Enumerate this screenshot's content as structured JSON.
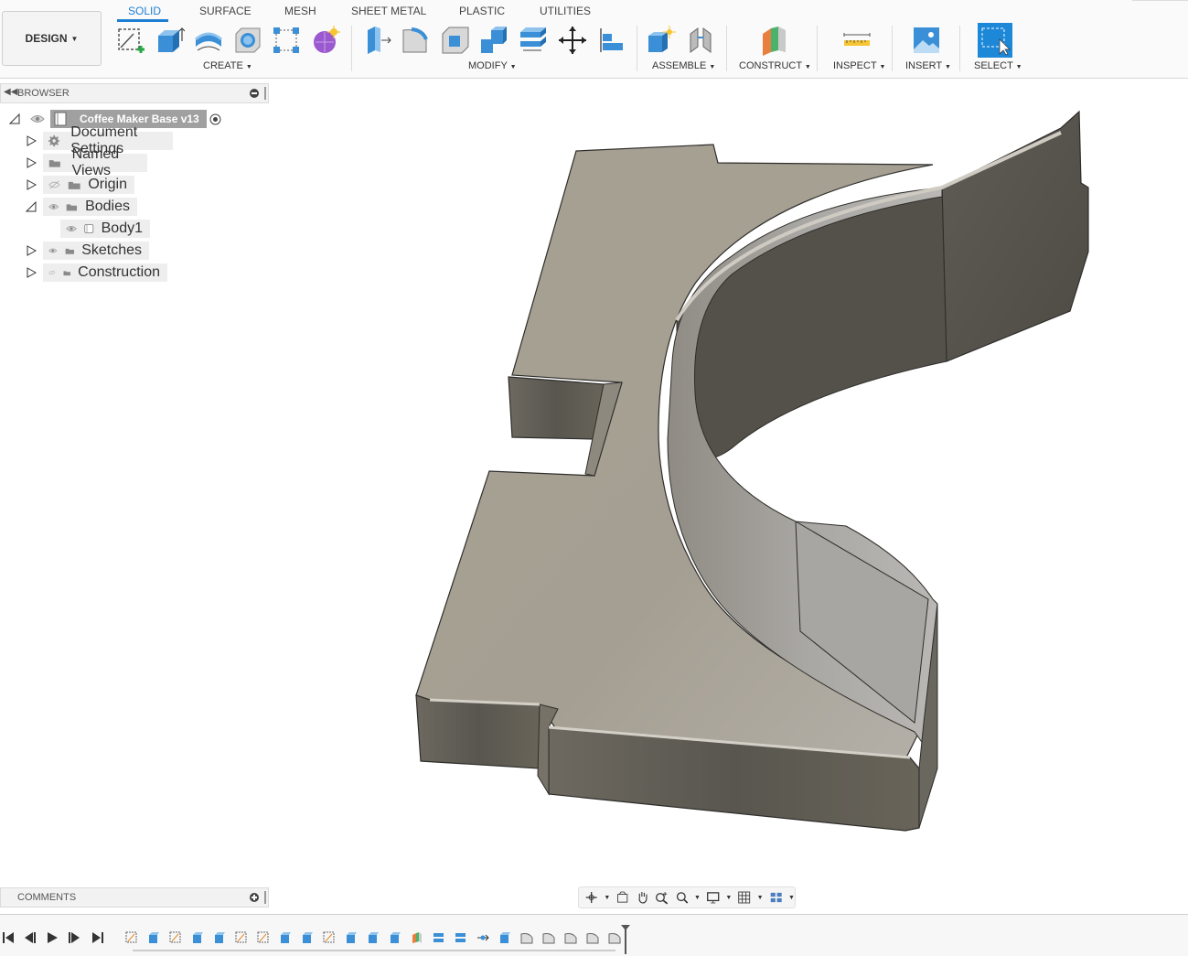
{
  "workspace": {
    "label": "DESIGN"
  },
  "tabs": [
    {
      "label": "SOLID",
      "active": true
    },
    {
      "label": "SURFACE",
      "active": false
    },
    {
      "label": "MESH",
      "active": false
    },
    {
      "label": "SHEET METAL",
      "active": false
    },
    {
      "label": "PLASTIC",
      "active": false
    },
    {
      "label": "UTILITIES",
      "active": false
    }
  ],
  "groups": {
    "create": "CREATE",
    "modify": "MODIFY",
    "assemble": "ASSEMBLE",
    "construct": "CONSTRUCT",
    "inspect": "INSPECT",
    "insert": "INSERT",
    "select": "SELECT"
  },
  "browser": {
    "title": "BROWSER",
    "document": "Coffee Maker Base v13",
    "items": [
      {
        "label": "Document Settings",
        "icon": "gear-icon"
      },
      {
        "label": "Named Views",
        "icon": "folder-icon"
      },
      {
        "label": "Origin",
        "icon": "folder-icon",
        "visibility": "hidden"
      },
      {
        "label": "Bodies",
        "icon": "folder-icon",
        "visibility": "visible",
        "expanded": true
      },
      {
        "label": "Body1",
        "icon": "body-icon",
        "visibility": "visible"
      },
      {
        "label": "Sketches",
        "icon": "folder-icon",
        "visibility": "visible"
      },
      {
        "label": "Construction",
        "icon": "folder-icon",
        "visibility": "hidden"
      }
    ]
  },
  "comments": {
    "title": "COMMENTS"
  },
  "colors": {
    "accent": "#1e7fd2",
    "model_top": "#a39d92",
    "model_side": "#625e57"
  }
}
